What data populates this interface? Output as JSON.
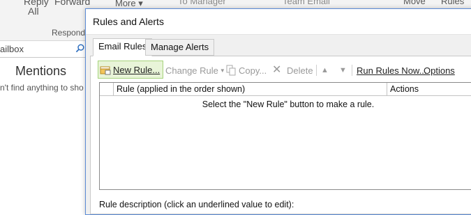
{
  "ribbon": {
    "reply_label": "Reply",
    "forward_label": "Forward",
    "all_label": "All",
    "more_label": "More",
    "manager_label": "To Manager",
    "team_email_label": "Team Email",
    "move_label": "Move",
    "rules_label": "Rules",
    "respond_group": "Respond"
  },
  "search": {
    "value": "ailbox"
  },
  "mentions": {
    "heading": "Mentions",
    "message": "n't find anything to sho"
  },
  "dialog": {
    "title": "Rules and Alerts",
    "tabs": [
      {
        "label": "Email Rules"
      },
      {
        "label": "Manage Alerts"
      }
    ],
    "toolbar": {
      "new_rule": "New Rule...",
      "change_rule": "Change Rule",
      "copy": "Copy...",
      "delete": "Delete",
      "run_rules_now": "Run Rules Now...",
      "options": "Options"
    },
    "grid": {
      "col_rule": "Rule (applied in the order shown)",
      "col_actions": "Actions",
      "empty_message": "Select the \"New Rule\" button to make a rule."
    },
    "description_label": "Rule description (click an underlined value to edit):"
  }
}
